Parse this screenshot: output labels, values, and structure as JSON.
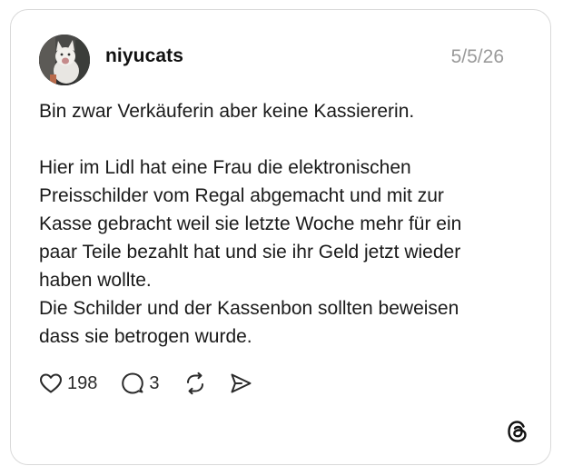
{
  "post": {
    "username": "niyucats",
    "date": "5/5/26",
    "avatar": "cat-avatar-photo",
    "lines": [
      "Bin zwar Verkäuferin aber keine Kassiererin.",
      "",
      "Hier im Lidl hat eine Frau die elektronischen",
      "Preisschilder vom Regal abgemacht und mit zur",
      "Kasse gebracht weil sie  letzte Woche mehr für ein",
      "paar Teile bezahlt hat und sie ihr Geld jetzt wieder",
      "haben wollte.",
      "Die Schilder und der Kassenbon sollten beweisen",
      "dass sie betrogen wurde."
    ]
  },
  "actions": {
    "likes": "198",
    "comments": "3",
    "icons": [
      "heart-icon",
      "comment-icon",
      "repost-icon",
      "share-icon"
    ]
  },
  "branding": {
    "logo": "threads-logo"
  }
}
